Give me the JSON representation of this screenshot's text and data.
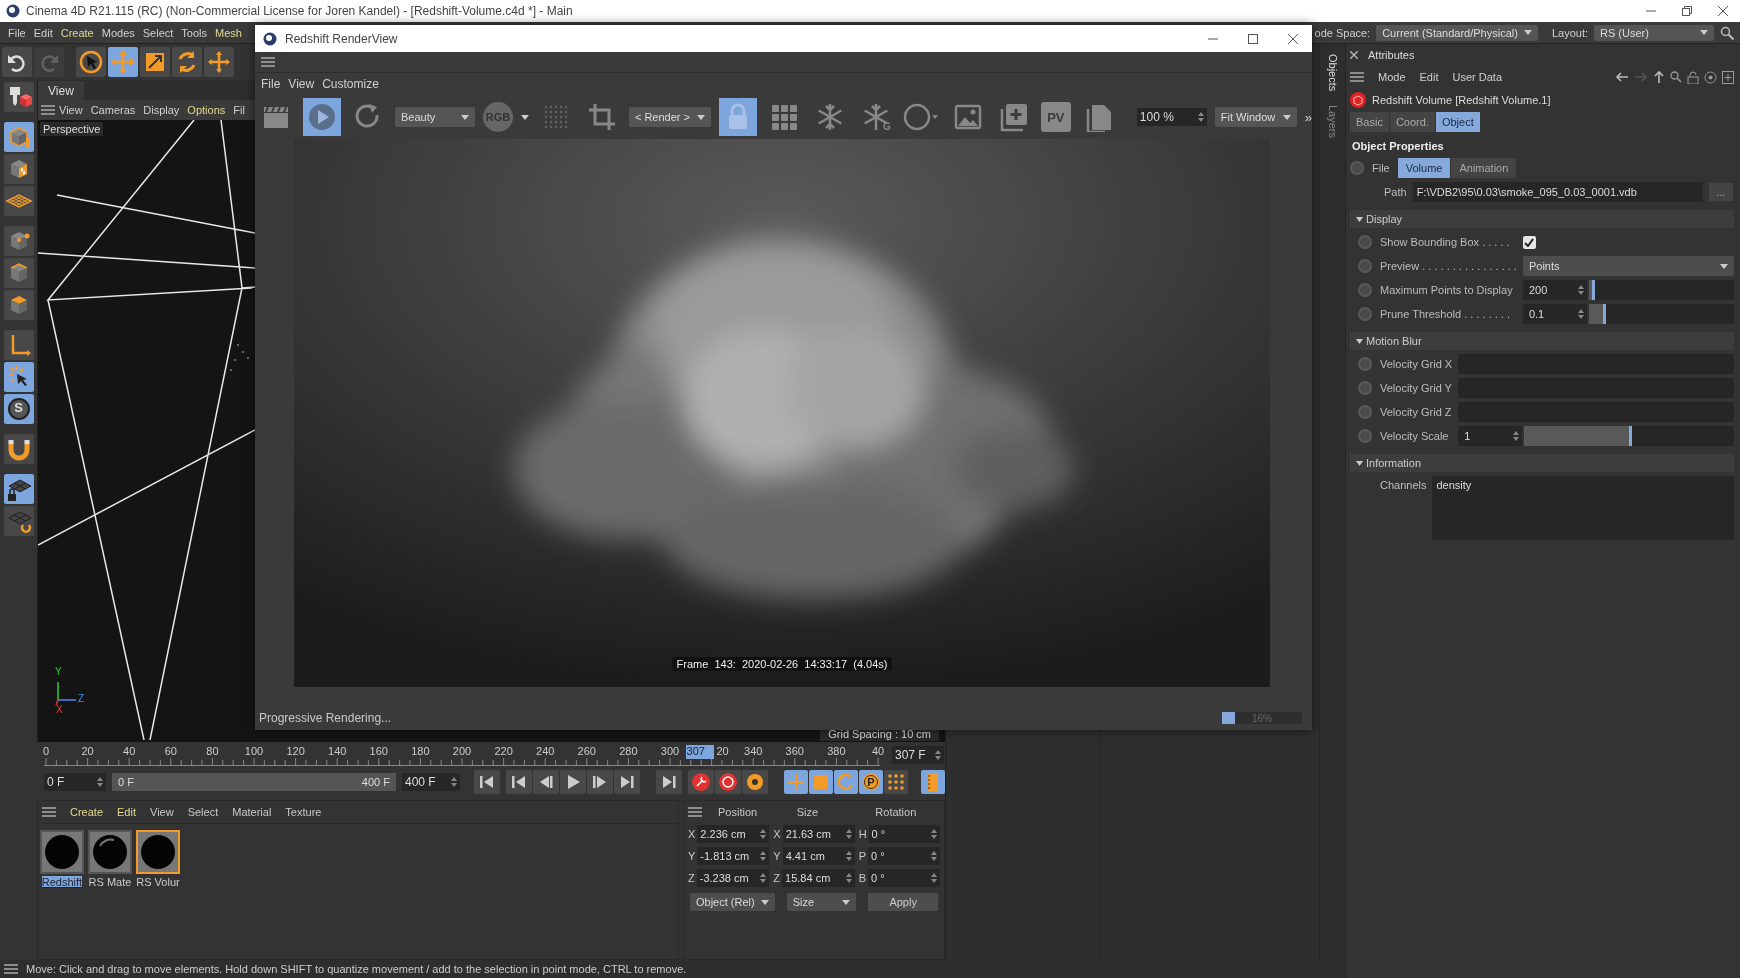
{
  "main_window": {
    "title": "Cinema 4D R21.115 (RC) (Non-Commercial License for Joren Kandel) - [Redshift-Volume.c4d *] - Main"
  },
  "menu_bar": [
    {
      "label": "File",
      "accent": false
    },
    {
      "label": "Edit",
      "accent": false
    },
    {
      "label": "Create",
      "accent": true
    },
    {
      "label": "Modes",
      "accent": false
    },
    {
      "label": "Select",
      "accent": false
    },
    {
      "label": "Tools",
      "accent": false
    },
    {
      "label": "Mesh",
      "accent": true
    }
  ],
  "node_space": {
    "label": "ode Space:",
    "value": "Current (Standard/Physical)"
  },
  "layout": {
    "label": "Layout:",
    "value": "RS (User)"
  },
  "history": [
    {
      "disabled": false
    },
    {
      "disabled": true
    }
  ],
  "tools": [
    {
      "selected": false
    },
    {
      "selected": true
    },
    {
      "selected": false
    },
    {
      "selected": false
    },
    {
      "selected": false
    }
  ],
  "left_toolbar": [
    {
      "selected": false
    },
    {
      "selected": true
    },
    {
      "selected": false
    },
    {
      "selected": false
    },
    {
      "selected": false
    },
    {
      "selected": false
    },
    {
      "selected": false
    },
    {
      "selected": false
    },
    {
      "selected": true
    },
    {
      "selected": true,
      "label": "S"
    },
    {
      "selected": false
    },
    {
      "selected": true
    },
    {
      "selected": false
    }
  ],
  "viewport": {
    "tab": "View",
    "menu": [
      {
        "label": "View",
        "accent": false
      },
      {
        "label": "Cameras",
        "accent": false
      },
      {
        "label": "Display",
        "accent": false
      },
      {
        "label": "Options",
        "accent": true
      },
      {
        "label": "Fil",
        "accent": false
      }
    ],
    "camera": "Perspective",
    "axis_labels": [
      "Y",
      "Z",
      "X"
    ],
    "grid_spacing": "Grid Spacing : 10 cm"
  },
  "render_view": {
    "title": "Redshift RenderView",
    "menu": [
      "File",
      "View",
      "Customize"
    ],
    "toolbar": [
      {
        "kind": "icon",
        "selected": false
      },
      {
        "kind": "icon",
        "selected": true
      },
      {
        "kind": "icon",
        "selected": false
      },
      {
        "kind": "dropdown",
        "value": "Beauty"
      },
      {
        "kind": "badge",
        "label": "RGB"
      },
      {
        "kind": "icon",
        "selected": false
      },
      {
        "kind": "icon",
        "selected": false
      },
      {
        "kind": "dropdown",
        "value": "< Render >"
      },
      {
        "kind": "icon",
        "selected": true
      },
      {
        "kind": "icon",
        "selected": false
      },
      {
        "kind": "icon",
        "selected": false
      },
      {
        "kind": "icon",
        "selected": false,
        "label": "G"
      },
      {
        "kind": "icon",
        "selected": false
      },
      {
        "kind": "icon",
        "selected": false
      },
      {
        "kind": "icon",
        "selected": false
      },
      {
        "kind": "badge",
        "label": "PV"
      },
      {
        "kind": "icon",
        "selected": false
      },
      {
        "kind": "spin",
        "value": "100 %"
      },
      {
        "kind": "dropdown",
        "value": "Fit Window"
      },
      {
        "kind": "more",
        "label": "»"
      }
    ],
    "frame_info": "Frame  143:  2020-02-26  14:33:17  (4.04s)",
    "status": "Progressive Rendering...",
    "progress": {
      "level": 0.16,
      "reading": "16%"
    }
  },
  "timeline": {
    "labels": [
      "0",
      "20",
      "40",
      "60",
      "80",
      "100",
      "120",
      "140",
      "160",
      "180",
      "200",
      "220",
      "240",
      "260",
      "280",
      "300",
      "20",
      "340",
      "360",
      "380",
      "40"
    ],
    "playhead": {
      "label": "307",
      "level": 0.7675
    },
    "current": "307 F"
  },
  "range": {
    "start": "0 F",
    "slider_start": "0 F",
    "slider_end": "400 F",
    "level": 1,
    "end": "400 F"
  },
  "mode_buttons": [
    {
      "selected": true
    },
    {
      "selected": true
    },
    {
      "selected": true
    },
    {
      "selected": true,
      "label": "P"
    },
    {
      "selected": false
    },
    {
      "selected": true
    }
  ],
  "materials": {
    "menu": [
      {
        "label": "Create",
        "accent": true
      },
      {
        "label": "Edit",
        "accent": true
      },
      {
        "label": "View",
        "accent": false
      },
      {
        "label": "Select",
        "accent": false
      },
      {
        "label": "Material",
        "accent": false
      },
      {
        "label": "Texture",
        "accent": false
      }
    ],
    "items": [
      {
        "name": "Redshift",
        "selected": true,
        "active": false
      },
      {
        "name": "RS Mate",
        "selected": false,
        "active": false
      },
      {
        "name": "RS Volur",
        "selected": false,
        "active": true
      }
    ]
  },
  "coordinates": {
    "headers": [
      "Position",
      "Size",
      "Rotation"
    ],
    "rows": [
      [
        {
          "axis": "X",
          "value": "2.236 cm"
        },
        {
          "axis": "X",
          "value": "21.63 cm"
        },
        {
          "axis": "H",
          "value": "0 °"
        }
      ],
      [
        {
          "axis": "Y",
          "value": "-1.813 cm"
        },
        {
          "axis": "Y",
          "value": "4.41 cm"
        },
        {
          "axis": "P",
          "value": "0 °"
        }
      ],
      [
        {
          "axis": "Z",
          "value": "-3.238 cm"
        },
        {
          "axis": "Z",
          "value": "15.84 cm"
        },
        {
          "axis": "B",
          "value": "0 °"
        }
      ]
    ],
    "mode": "Object (Rel)",
    "size_mode": "Size",
    "apply": "Apply"
  },
  "side_tabs": [
    {
      "label": "Objects",
      "selected": true
    },
    {
      "label": "Layers",
      "selected": false
    }
  ],
  "attributes": {
    "title": "Attributes",
    "menu": [
      "Mode",
      "Edit",
      "User Data"
    ],
    "object": "Redshift Volume [Redshift Volume.1]",
    "tabs": [
      {
        "label": "Basic",
        "selected": false
      },
      {
        "label": "Coord.",
        "selected": false
      },
      {
        "label": "Object",
        "selected": true
      }
    ],
    "heading": "Object Properties",
    "file": {
      "label": "File",
      "keyed": false,
      "tabs": [
        {
          "label": "Volume",
          "selected": true
        },
        {
          "label": "Animation",
          "selected": false
        }
      ],
      "path_label": "Path",
      "path": "F:\\VDB2\\95\\0.03\\smoke_095_0.03_0001.vdb",
      "browse": "..."
    },
    "sections": [
      {
        "title": "Display",
        "expanded": true,
        "rows": [
          {
            "kind": "checkbox",
            "label": "Show Bounding Box . . . . .",
            "checked": true,
            "keyed": false
          },
          {
            "kind": "dropdown",
            "label": "Preview . . . . . . . . . . . . . . . .",
            "value": "Points",
            "keyed": false
          },
          {
            "kind": "slider",
            "label": "Maximum Points to Display",
            "value": "200",
            "level": 0.02,
            "keyed": false
          },
          {
            "kind": "slider",
            "label": "Prune Threshold . . . . . . . .",
            "value": "0.1",
            "level": 0.1,
            "keyed": false
          }
        ]
      },
      {
        "title": "Motion Blur",
        "expanded": true,
        "rows": [
          {
            "kind": "field",
            "label": "Velocity Grid X",
            "keyed": false
          },
          {
            "kind": "field",
            "label": "Velocity Grid Y",
            "keyed": false
          },
          {
            "kind": "field",
            "label": "Velocity Grid Z",
            "keyed": false
          },
          {
            "kind": "slider",
            "label": "Velocity Scale",
            "value": "1",
            "level": 0.5,
            "keyed": false
          }
        ]
      },
      {
        "title": "Information",
        "expanded": true,
        "rows": [
          {
            "kind": "textarea",
            "label": "Channels",
            "value": "density"
          }
        ]
      }
    ]
  },
  "status_bar": "Move: Click and drag to move elements. Hold down SHIFT to quantize movement / add to the selection in point mode, CTRL to remove."
}
